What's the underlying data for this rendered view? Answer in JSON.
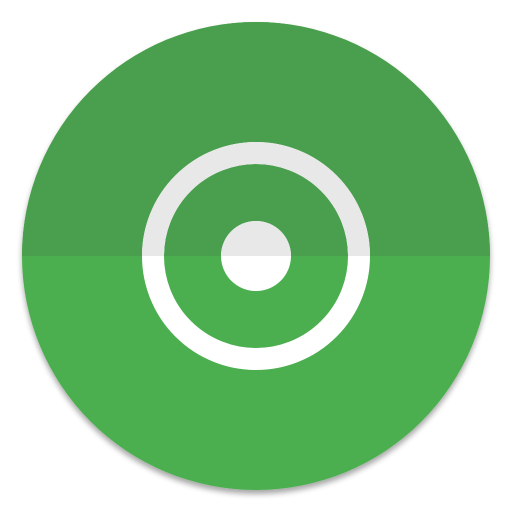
{
  "icon": {
    "name": "target-app-icon",
    "symbol": "record-target-icon",
    "colors": {
      "disc_top": "#4a9f4d",
      "disc_bottom": "#4caf50",
      "ring": "#ffffff",
      "ring_top_shade": "#e8e8e8",
      "dot": "#ffffff",
      "dot_top_shade": "#e8e8e8",
      "shadow": "#2e6b31"
    }
  }
}
